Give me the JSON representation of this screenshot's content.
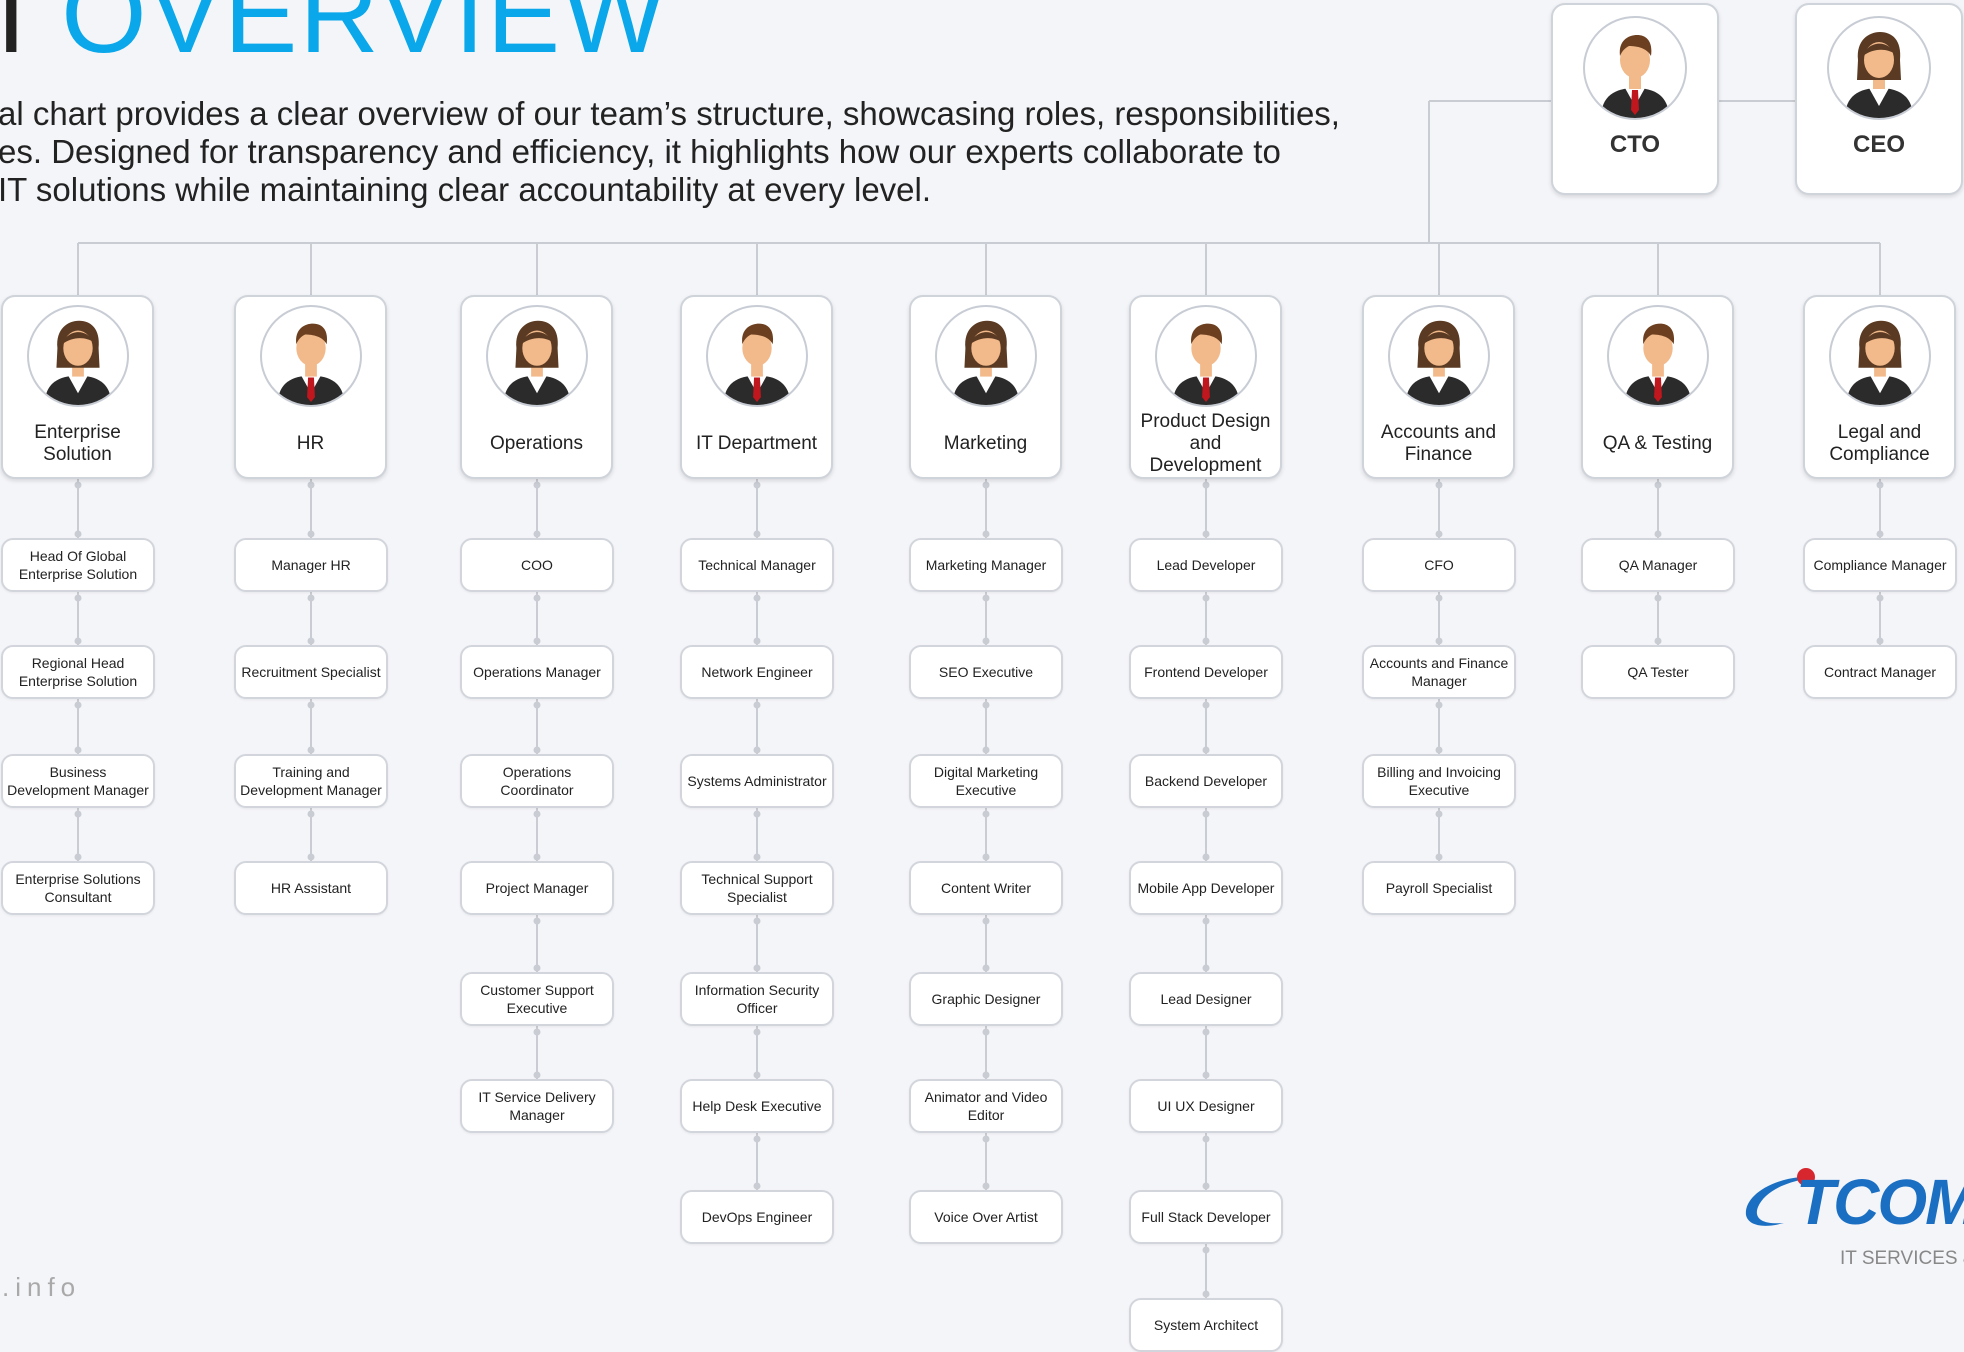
{
  "header": {
    "title_part1": "I",
    "title_part2": "OVERVIEW",
    "intro_lines": [
      "al chart provides a clear overview of our team’s structure, showcasing roles, responsibilities,",
      "es. Designed for transparency and efficiency, it highlights how our experts collaborate to",
      "IT solutions while maintaining clear accountability at every level."
    ]
  },
  "footer_text": ".info",
  "logo": {
    "wordmark": "TCOMI",
    "tagline": "IT SERVICES &"
  },
  "colors": {
    "accent": "#0aa8ea",
    "connector": "#c9ccd3",
    "card_border": "#cfd3da"
  },
  "executives": [
    {
      "label": "CTO",
      "gender": "male"
    },
    {
      "label": "CEO",
      "gender": "female"
    }
  ],
  "departments": [
    {
      "label": "Enterprise Solution",
      "gender": "female",
      "roles": [
        "Head Of Global Enterprise Solution",
        "Regional Head Enterprise Solution",
        "Business Development Manager",
        "Enterprise Solutions Consultant"
      ]
    },
    {
      "label": "HR",
      "gender": "male",
      "roles": [
        "Manager HR",
        "Recruitment Specialist",
        "Training and Development Manager",
        "HR Assistant"
      ]
    },
    {
      "label": "Operations",
      "gender": "female",
      "roles": [
        "COO",
        "Operations Manager",
        "Operations Coordinator",
        "Project Manager",
        "Customer Support Executive",
        "IT Service Delivery Manager"
      ]
    },
    {
      "label": "IT Department",
      "gender": "male",
      "roles": [
        "Technical Manager",
        "Network Engineer",
        "Systems Administrator",
        "Technical Support Specialist",
        "Information Security Officer",
        "Help Desk Executive",
        "DevOps Engineer"
      ]
    },
    {
      "label": "Marketing",
      "gender": "female",
      "roles": [
        "Marketing Manager",
        "SEO Executive",
        "Digital Marketing Executive",
        "Content Writer",
        "Graphic Designer",
        "Animator and Video Editor",
        "Voice Over Artist"
      ]
    },
    {
      "label": "Product Design and Development",
      "gender": "male",
      "roles": [
        "Lead Developer",
        "Frontend Developer",
        "Backend Developer",
        "Mobile App Developer",
        "Lead Designer",
        "UI UX Designer",
        "Full Stack Developer",
        "System Architect"
      ]
    },
    {
      "label": "Accounts and Finance",
      "gender": "female",
      "roles": [
        "CFO",
        "Accounts and Finance Manager",
        "Billing and Invoicing Executive",
        "Payroll Specialist"
      ]
    },
    {
      "label": "QA & Testing",
      "gender": "male",
      "roles": [
        "QA Manager",
        "QA Tester"
      ]
    },
    {
      "label": "Legal and Compliance",
      "gender": "female",
      "roles": [
        "Compliance Manager",
        "Contract Manager"
      ]
    }
  ]
}
